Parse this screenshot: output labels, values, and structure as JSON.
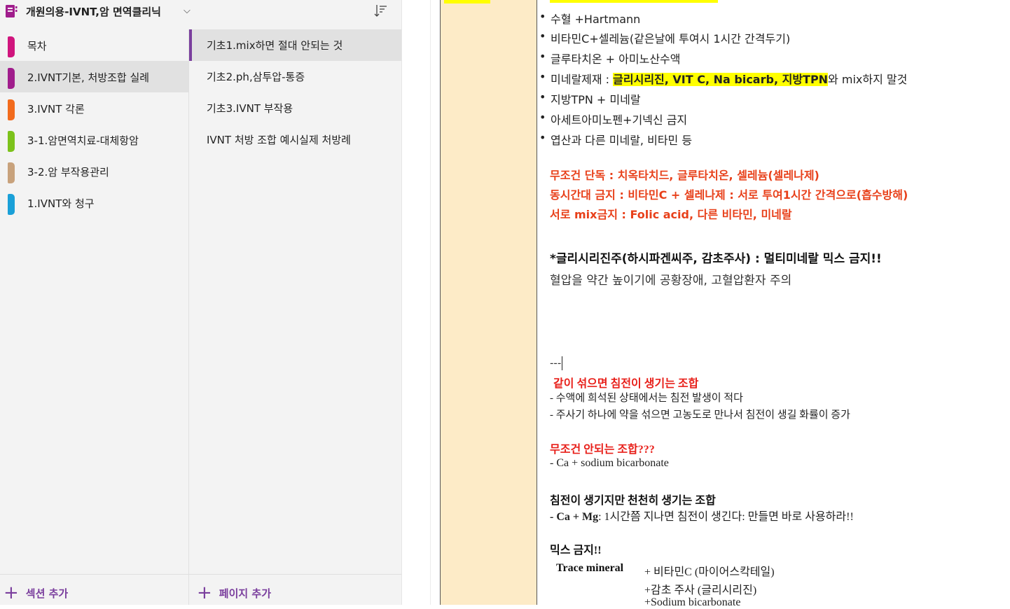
{
  "notebook": {
    "title": "개원의용-IVNT,암 면역클리닉",
    "accent": "#a01d8c"
  },
  "sections": [
    {
      "label": "목차",
      "color": "#d0157d",
      "selected": false
    },
    {
      "label": "2.IVNT기본, 처방조합 실례",
      "color": "#a01d8c",
      "selected": true
    },
    {
      "label": "3.IVNT 각론",
      "color": "#f26b1d",
      "selected": false
    },
    {
      "label": "3-1.암면역치료-대체항암",
      "color": "#7cc21b",
      "selected": false
    },
    {
      "label": "3-2.암 부작용관리",
      "color": "#c8a27c",
      "selected": false
    },
    {
      "label": "1.IVNT와 청구",
      "color": "#1aa0d8",
      "selected": false
    }
  ],
  "pages": [
    {
      "label": "기초1.mix하면 절대 안되는 것",
      "selected": true
    },
    {
      "label": "기초2.ph,삼투압-통증",
      "selected": false
    },
    {
      "label": "기초3.IVNT 부작용",
      "selected": false
    },
    {
      "label": "IVNT 처방 조합 예시실제 처방례",
      "selected": false
    }
  ],
  "footer": {
    "add_section": "섹션 추가",
    "add_page": "페이지 추가"
  },
  "content": {
    "bullets": [
      {
        "before": "수혈 +Hartmann",
        "highlight": "",
        "after": ""
      },
      {
        "before": "비타민C+셀레늄(같은날에 투여시 1시간 간격두기)",
        "highlight": "",
        "after": ""
      },
      {
        "before": "글루타치온 + 아미노산수액",
        "highlight": "",
        "after": ""
      },
      {
        "before": "미네랄제재 : ",
        "highlight": "글리시리진, VIT C, Na bicarb, 지방TPN",
        "after": "와 mix하지 말것"
      },
      {
        "before": "지방TPN + 미네랄",
        "highlight": "",
        "after": ""
      },
      {
        "before": "아세트아미노펜+기넥신 금지",
        "highlight": "",
        "after": ""
      },
      {
        "before": "엽산과 다른 미네랄, 비타민 등",
        "highlight": "",
        "after": ""
      }
    ],
    "red_lines": [
      "무조건 단독 : 치옥타치드, 글루타치온, 셀레늄(셀레나제)",
      "동시간대 금지 : 비타민C + 셀레나제 : 서로 투여1시간 간격으로(흡수방해)",
      "서로 mix금지 : Folic acid, 다른 비타민, 미네랄"
    ],
    "glycyrrhizin_heading": "*글리시리진주(하시파겐씨주, 감초주사) : 멀티미네랄 믹스 금지!!",
    "glycyrrhizin_note": "혈압을 약간 높이기에 공황장애, 고혈압환자 주의",
    "dashes": "---",
    "precip_heading": "같이 섞으면 침전이 생기는 조합",
    "precip_lines": [
      "- 수액에 희석된 상태에서는 침전 발생이 적다",
      "- 주사기 하나에 약을 섞으면 고농도로 만나서 침전이 생길 화률이 증가"
    ],
    "never_heading": "무조건 안되는 조합???",
    "never_line": "- Ca + sodium bicarbonate",
    "slow_heading": "침전이 생기지만 천천히 생기는 조합",
    "slow_line_bold": "- Ca + Mg",
    "slow_line_rest": ": 1시간쯤 지나면 침전이 생긴다: 만들면 바로 사용하라!!",
    "mix_ban_heading": "믹스 금지!!",
    "trace_label": "Trace mineral",
    "trace_items": [
      "+ 비타민C (마이어스칵테일)",
      "+감초 주사 (글리시리진)",
      "+Sodium bicarbonate"
    ]
  }
}
